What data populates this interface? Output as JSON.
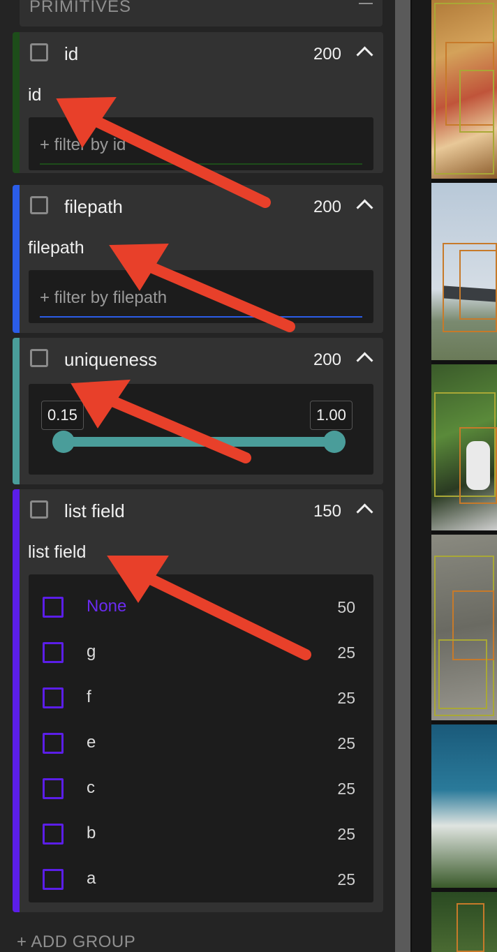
{
  "sidebar": {
    "group_title": "PRIMITIVES",
    "add_group_label": "+ ADD GROUP",
    "fields": [
      {
        "name": "id",
        "count": "200",
        "sub_label": "id",
        "filter_placeholder": "+ filter by id",
        "color": "#1d4d1a"
      },
      {
        "name": "filepath",
        "count": "200",
        "sub_label": "filepath",
        "filter_placeholder": "+ filter by filepath",
        "color": "#2b5de8"
      },
      {
        "name": "uniqueness",
        "count": "200",
        "slider_min": "0.15",
        "slider_max": "1.00",
        "color": "#4a9d9a"
      },
      {
        "name": "list field",
        "count": "150",
        "sub_label": "list field",
        "color": "#5b1ee8",
        "values": [
          {
            "label": "None",
            "count": "50"
          },
          {
            "label": "g",
            "count": "25"
          },
          {
            "label": "f",
            "count": "25"
          },
          {
            "label": "e",
            "count": "25"
          },
          {
            "label": "c",
            "count": "25"
          },
          {
            "label": "b",
            "count": "25"
          },
          {
            "label": "a",
            "count": "25"
          }
        ]
      }
    ]
  },
  "colors": {
    "annotation_arrow": "#e8402a",
    "list_accent": "#5b1ee8"
  },
  "icons": {
    "collapse": "minus-icon",
    "expand": "chevron-up-icon",
    "checkbox": "checkbox-icon"
  }
}
